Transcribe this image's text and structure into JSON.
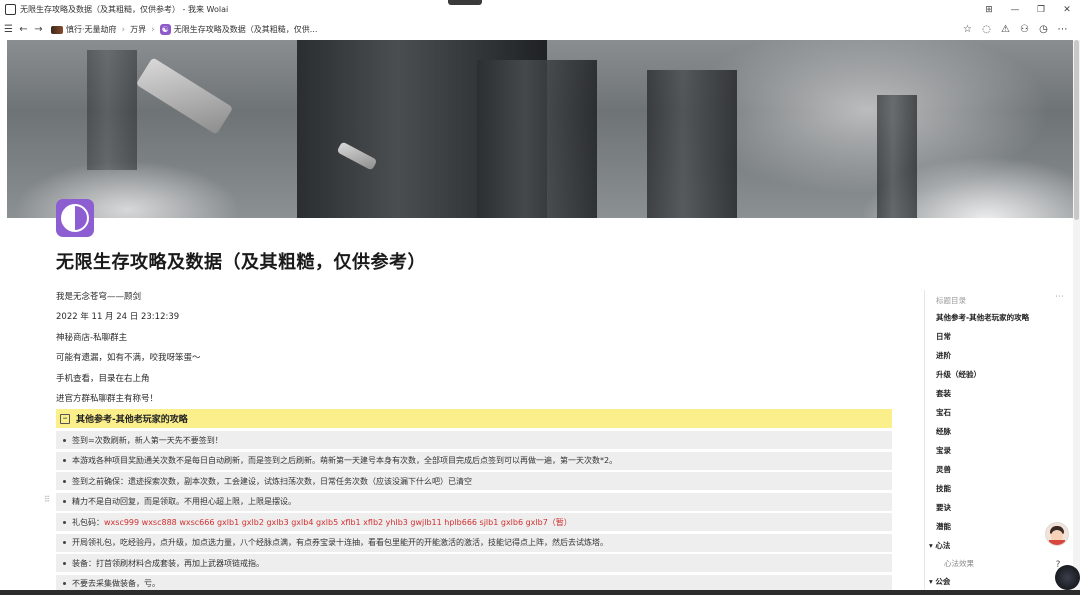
{
  "window": {
    "title": "无限生存攻略及数据（及其粗糙，仅供参考） - 我来 Wolai",
    "controls": [
      "⊞",
      "—",
      "❐",
      "✕"
    ]
  },
  "nav": {
    "menu_icon": "☰",
    "back_icon": "←",
    "forward_icon": "→",
    "breadcrumbs": [
      "慎行·无量劫府",
      "万界",
      "无限生存攻略及数据（及其粗糙，仅供..."
    ],
    "right_icons": [
      "☆",
      "comment-icon",
      "share-icon",
      "add-user-icon",
      "history-icon",
      "more-icon"
    ]
  },
  "page": {
    "title": "无限生存攻略及数据（及其粗糙，仅供参考）",
    "paragraphs": [
      "我是无念苍穹——顾剑",
      "2022 年 11 月 24 日 23:12:39",
      "神秘商店-私聊群主",
      "可能有遗漏，如有不满，咬我呀笨蛋～",
      "手机查看，目录在右上角",
      "进官方群私聊群主有称号！"
    ],
    "heading": "其他参考-其他老玩家的攻略",
    "bullets": [
      {
        "text": "签到=次数刷新，新人第一天先不要签到！",
        "red": ""
      },
      {
        "text": "本游戏各种项目奖励通关次数不是每日自动刷新，而是签到之后刷新。萌新第一天建号本身有次数，全部项目完成后点签到可以再做一遍，第一天次数*2。",
        "red": ""
      },
      {
        "text": "签到之前确保：遗迹探索次数，副本次数，工会建设，试炼扫荡次数，日常任务次数（应该没漏下什么吧）已清空",
        "red": ""
      },
      {
        "text": "精力不是自动回复，而是领取。不用担心超上限，上限是摆设。",
        "red": ""
      },
      {
        "text": "礼包码：",
        "red": "wxsc999 wxsc888 wxsc666 gxlb1 gxlb2 gxlb3 gxlb4 gxlb5 xflb1 xflb2 yhlb3 gwjlb11 hplb666 sjlb1 gxlb6 gxlb7（暂）"
      },
      {
        "text": "开局领礼包，吃经验丹，点升级，加点选力量，八个经脉点满，有点券宝录十连抽，看看包里能开的开能激活的激活，技能记得点上阵，然后去试炼塔。",
        "red": ""
      },
      {
        "text": "装备：打首领刷材料合成套装，再加上武器项链戒指。",
        "red": ""
      },
      {
        "text": "不要去采集做装备，亏。",
        "red": ""
      }
    ]
  },
  "outline": {
    "title": "标题目录",
    "items": [
      "其他参考-其他老玩家的攻略",
      "日常",
      "进阶",
      "升级（经验）",
      "套装",
      "宝石",
      "经脉",
      "宝录",
      "灵兽",
      "技能",
      "要诀",
      "潜能",
      "▾ 心法",
      "心法效果",
      "▾ 公会"
    ]
  },
  "floating": {
    "help": "?"
  },
  "colors": {
    "accent_purple": "#8c5ed1",
    "heading_bg": "#fbef8c",
    "bullet_bg": "#eeeeee",
    "code_red": "#d03030"
  }
}
